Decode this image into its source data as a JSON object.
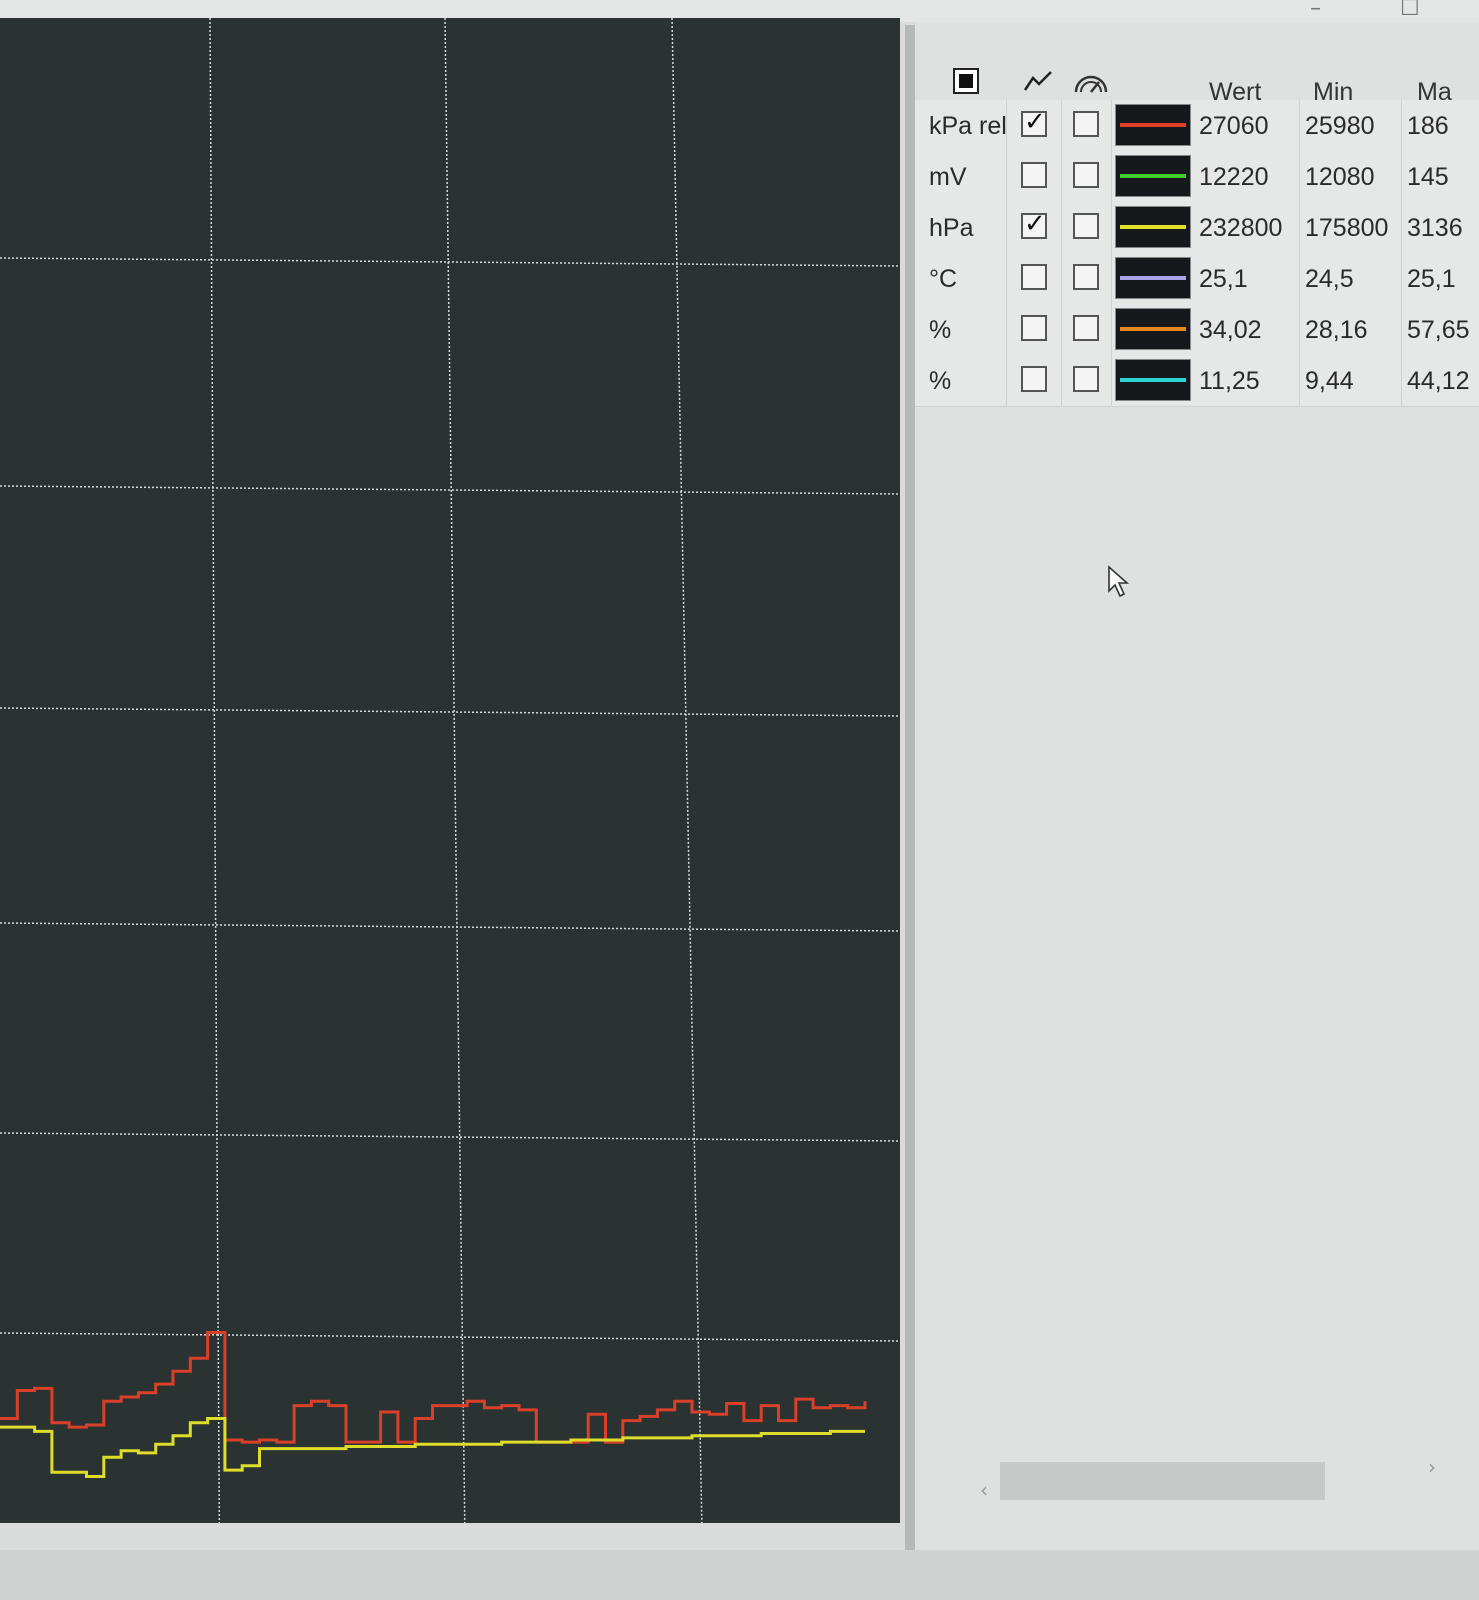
{
  "window": {
    "minimize_glyph": "–",
    "maximize_glyph": "☐"
  },
  "table": {
    "header": {
      "select_icon": "stop-square-icon",
      "chart_icon": "line-chart-icon",
      "gauge_icon": "gauge-icon",
      "col_wert": "Wert",
      "col_min": "Min",
      "col_max": "Ma"
    },
    "rows": [
      {
        "unit": "kPa rel",
        "chart_checked": true,
        "gauge_checked": false,
        "color": "#e0402a",
        "wert": "27060",
        "min": "25980",
        "max": "186"
      },
      {
        "unit": "mV",
        "chart_checked": false,
        "gauge_checked": false,
        "color": "#3fcf2f",
        "wert": "12220",
        "min": "12080",
        "max": "145"
      },
      {
        "unit": "hPa",
        "chart_checked": true,
        "gauge_checked": false,
        "color": "#e3e02a",
        "wert": "232800",
        "min": "175800",
        "max": "3136"
      },
      {
        "unit": "°C",
        "chart_checked": false,
        "gauge_checked": false,
        "color": "#a9a2e6",
        "wert": "25,1",
        "min": "24,5",
        "max": "25,1"
      },
      {
        "unit": "%",
        "chart_checked": false,
        "gauge_checked": false,
        "color": "#e8871e",
        "wert": "34,02",
        "min": "28,16",
        "max": "57,65"
      },
      {
        "unit": "%",
        "chart_checked": false,
        "gauge_checked": false,
        "color": "#2fd4d4",
        "wert": "11,25",
        "min": "9,44",
        "max": "44,12"
      }
    ]
  },
  "chart_data": {
    "type": "line",
    "background": "#2b3232",
    "grid": true,
    "x": [
      0,
      2,
      4,
      6,
      8,
      10,
      12,
      14,
      16,
      18,
      20,
      22,
      24,
      26,
      28,
      30,
      32,
      34,
      36,
      38,
      40,
      42,
      44,
      46,
      48,
      50,
      52,
      54,
      56,
      58,
      60,
      62,
      64,
      66,
      68,
      70,
      72,
      74,
      76,
      78,
      80,
      82,
      84,
      86,
      88,
      90,
      92,
      94,
      96,
      98,
      100
    ],
    "series": [
      {
        "color": "#d8402a",
        "values": [
          3.0,
          4.3,
          4.4,
          2.8,
          2.6,
          2.7,
          3.8,
          4.0,
          4.2,
          4.6,
          5.2,
          5.8,
          7.0,
          2.0,
          1.9,
          2.0,
          1.9,
          3.6,
          3.8,
          3.6,
          1.9,
          1.9,
          3.3,
          1.9,
          3.0,
          3.6,
          3.6,
          3.8,
          3.5,
          3.6,
          3.4,
          1.9,
          1.9,
          1.9,
          3.2,
          1.9,
          2.9,
          3.1,
          3.4,
          3.8,
          3.3,
          3.2,
          3.7,
          2.9,
          3.6,
          2.9,
          3.9,
          3.5,
          3.6,
          3.5,
          3.8
        ]
      },
      {
        "color": "#dede2a",
        "values": [
          2.6,
          2.6,
          2.4,
          0.5,
          0.5,
          0.3,
          1.2,
          1.5,
          1.4,
          1.8,
          2.2,
          2.8,
          3.0,
          0.6,
          0.8,
          1.6,
          1.6,
          1.6,
          1.6,
          1.6,
          1.7,
          1.7,
          1.7,
          1.7,
          1.8,
          1.8,
          1.8,
          1.8,
          1.8,
          1.9,
          1.9,
          1.9,
          1.9,
          2.0,
          2.0,
          2.0,
          2.1,
          2.1,
          2.1,
          2.1,
          2.2,
          2.2,
          2.2,
          2.2,
          2.3,
          2.3,
          2.3,
          2.3,
          2.4,
          2.4,
          2.4
        ]
      }
    ],
    "ylim": [
      0,
      70
    ],
    "xlim": [
      0,
      100
    ]
  }
}
